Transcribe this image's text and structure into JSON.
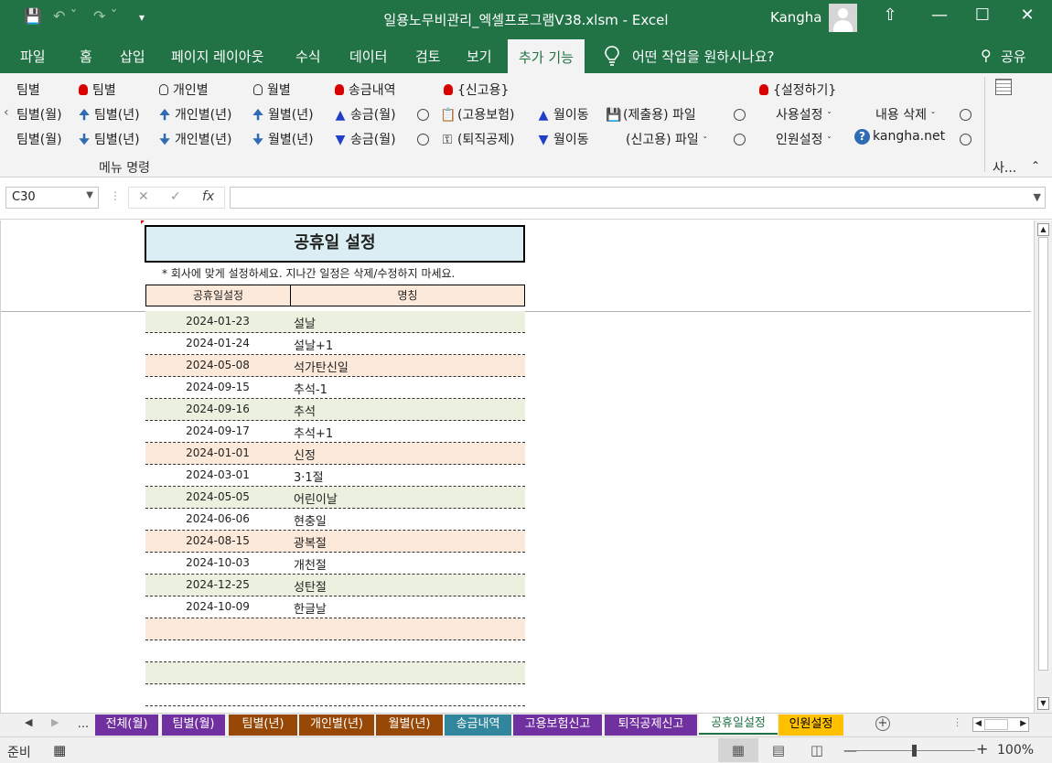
{
  "window": {
    "title": "일용노무비관리_엑셀프로그램V38.xlsm  -  Excel",
    "user": "Kangha",
    "qa_icons": [
      "save-icon",
      "undo-icon",
      "redo-icon",
      "customize-icon"
    ],
    "buttons": [
      "ribbon-display-icon",
      "minimize-icon",
      "maximize-icon",
      "close-icon"
    ]
  },
  "tabs": {
    "items": [
      "파일",
      "홈",
      "삽입",
      "페이지 레이아웃",
      "수식",
      "데이터",
      "검토",
      "보기",
      "추가 기능"
    ],
    "active": "추가 기능",
    "tell_me": "어떤 작업을 원하시나요?",
    "share": "공유"
  },
  "ribbon": {
    "col1": [
      "팀별",
      "팀별(월)",
      "팀별(월)"
    ],
    "col2": [
      "팀별",
      "팀별(년)",
      "팀별(년)"
    ],
    "col3": [
      "개인별",
      "개인별(년)",
      "개인별(년)"
    ],
    "col4": [
      "월별",
      "월별(년)",
      "월별(년)"
    ],
    "col5": [
      "송금내역",
      "송금(월)",
      "송금(월)"
    ],
    "col6": [
      "{신고용}",
      "(고용보험)",
      "(퇴직공제)"
    ],
    "col7": [
      "월이동",
      "월이동"
    ],
    "col8": [
      "(제출용) 파일",
      "(신고용) 파일"
    ],
    "col9": [
      "{설정하기}",
      "사용설정",
      "인원설정"
    ],
    "col10": [
      "내용 삭제",
      "kangha.net"
    ],
    "group_label": "메뉴 명령",
    "collapsed_label": "사..."
  },
  "formula_bar": {
    "name_box": "C30",
    "formula": ""
  },
  "sheet": {
    "title": "공휴일 설정",
    "note": "* 회사에 맞게 설정하세요. 지나간 일정은 삭제/수정하지 마세요.",
    "headers": [
      "공휴일설정",
      "명칭"
    ],
    "rows": [
      {
        "date": "2024-01-23",
        "name": "설날",
        "bg": "g"
      },
      {
        "date": "2024-01-24",
        "name": "설날+1",
        "bg": "w"
      },
      {
        "date": "2024-05-08",
        "name": "석가탄신일",
        "bg": "p"
      },
      {
        "date": "2024-09-15",
        "name": "추석-1",
        "bg": "w"
      },
      {
        "date": "2024-09-16",
        "name": "추석",
        "bg": "g"
      },
      {
        "date": "2024-09-17",
        "name": "추석+1",
        "bg": "w"
      },
      {
        "date": "2024-01-01",
        "name": "신정",
        "bg": "p"
      },
      {
        "date": "2024-03-01",
        "name": "3·1절",
        "bg": "w"
      },
      {
        "date": "2024-05-05",
        "name": "어린이날",
        "bg": "g"
      },
      {
        "date": "2024-06-06",
        "name": "현충일",
        "bg": "w"
      },
      {
        "date": "2024-08-15",
        "name": "광복절",
        "bg": "p"
      },
      {
        "date": "2024-10-03",
        "name": "개천절",
        "bg": "w"
      },
      {
        "date": "2024-12-25",
        "name": "성탄절",
        "bg": "g"
      },
      {
        "date": "2024-10-09",
        "name": "한글날",
        "bg": "w"
      },
      {
        "date": "",
        "name": "",
        "bg": "p"
      },
      {
        "date": "",
        "name": "",
        "bg": "w"
      },
      {
        "date": "",
        "name": "",
        "bg": "g"
      },
      {
        "date": "",
        "name": "",
        "bg": "w"
      }
    ]
  },
  "sheet_tabs": [
    {
      "label": "...",
      "color": "#f0f0f0",
      "text": "#333"
    },
    {
      "label": "전체(월)",
      "color": "#7030a0",
      "text": "#ffffff"
    },
    {
      "label": "팀별(월)",
      "color": "#7030a0",
      "text": "#ffffff"
    },
    {
      "label": "팀별(년)",
      "color": "#974806",
      "text": "#ffffff"
    },
    {
      "label": "개인별(년)",
      "color": "#974806",
      "text": "#ffffff"
    },
    {
      "label": "월별(년)",
      "color": "#974806",
      "text": "#ffffff"
    },
    {
      "label": "송금내역",
      "color": "#31859c",
      "text": "#ffffff"
    },
    {
      "label": "고용보험신고",
      "color": "#7030a0",
      "text": "#ffffff"
    },
    {
      "label": "퇴직공제신고",
      "color": "#7030a0",
      "text": "#ffffff"
    },
    {
      "label": "공휴일설정",
      "color": "#ffffff",
      "text": "#217346"
    },
    {
      "label": "인원설정",
      "color": "#ffc000",
      "text": "#000000"
    }
  ],
  "status": {
    "ready": "준비",
    "zoom": "100%"
  }
}
